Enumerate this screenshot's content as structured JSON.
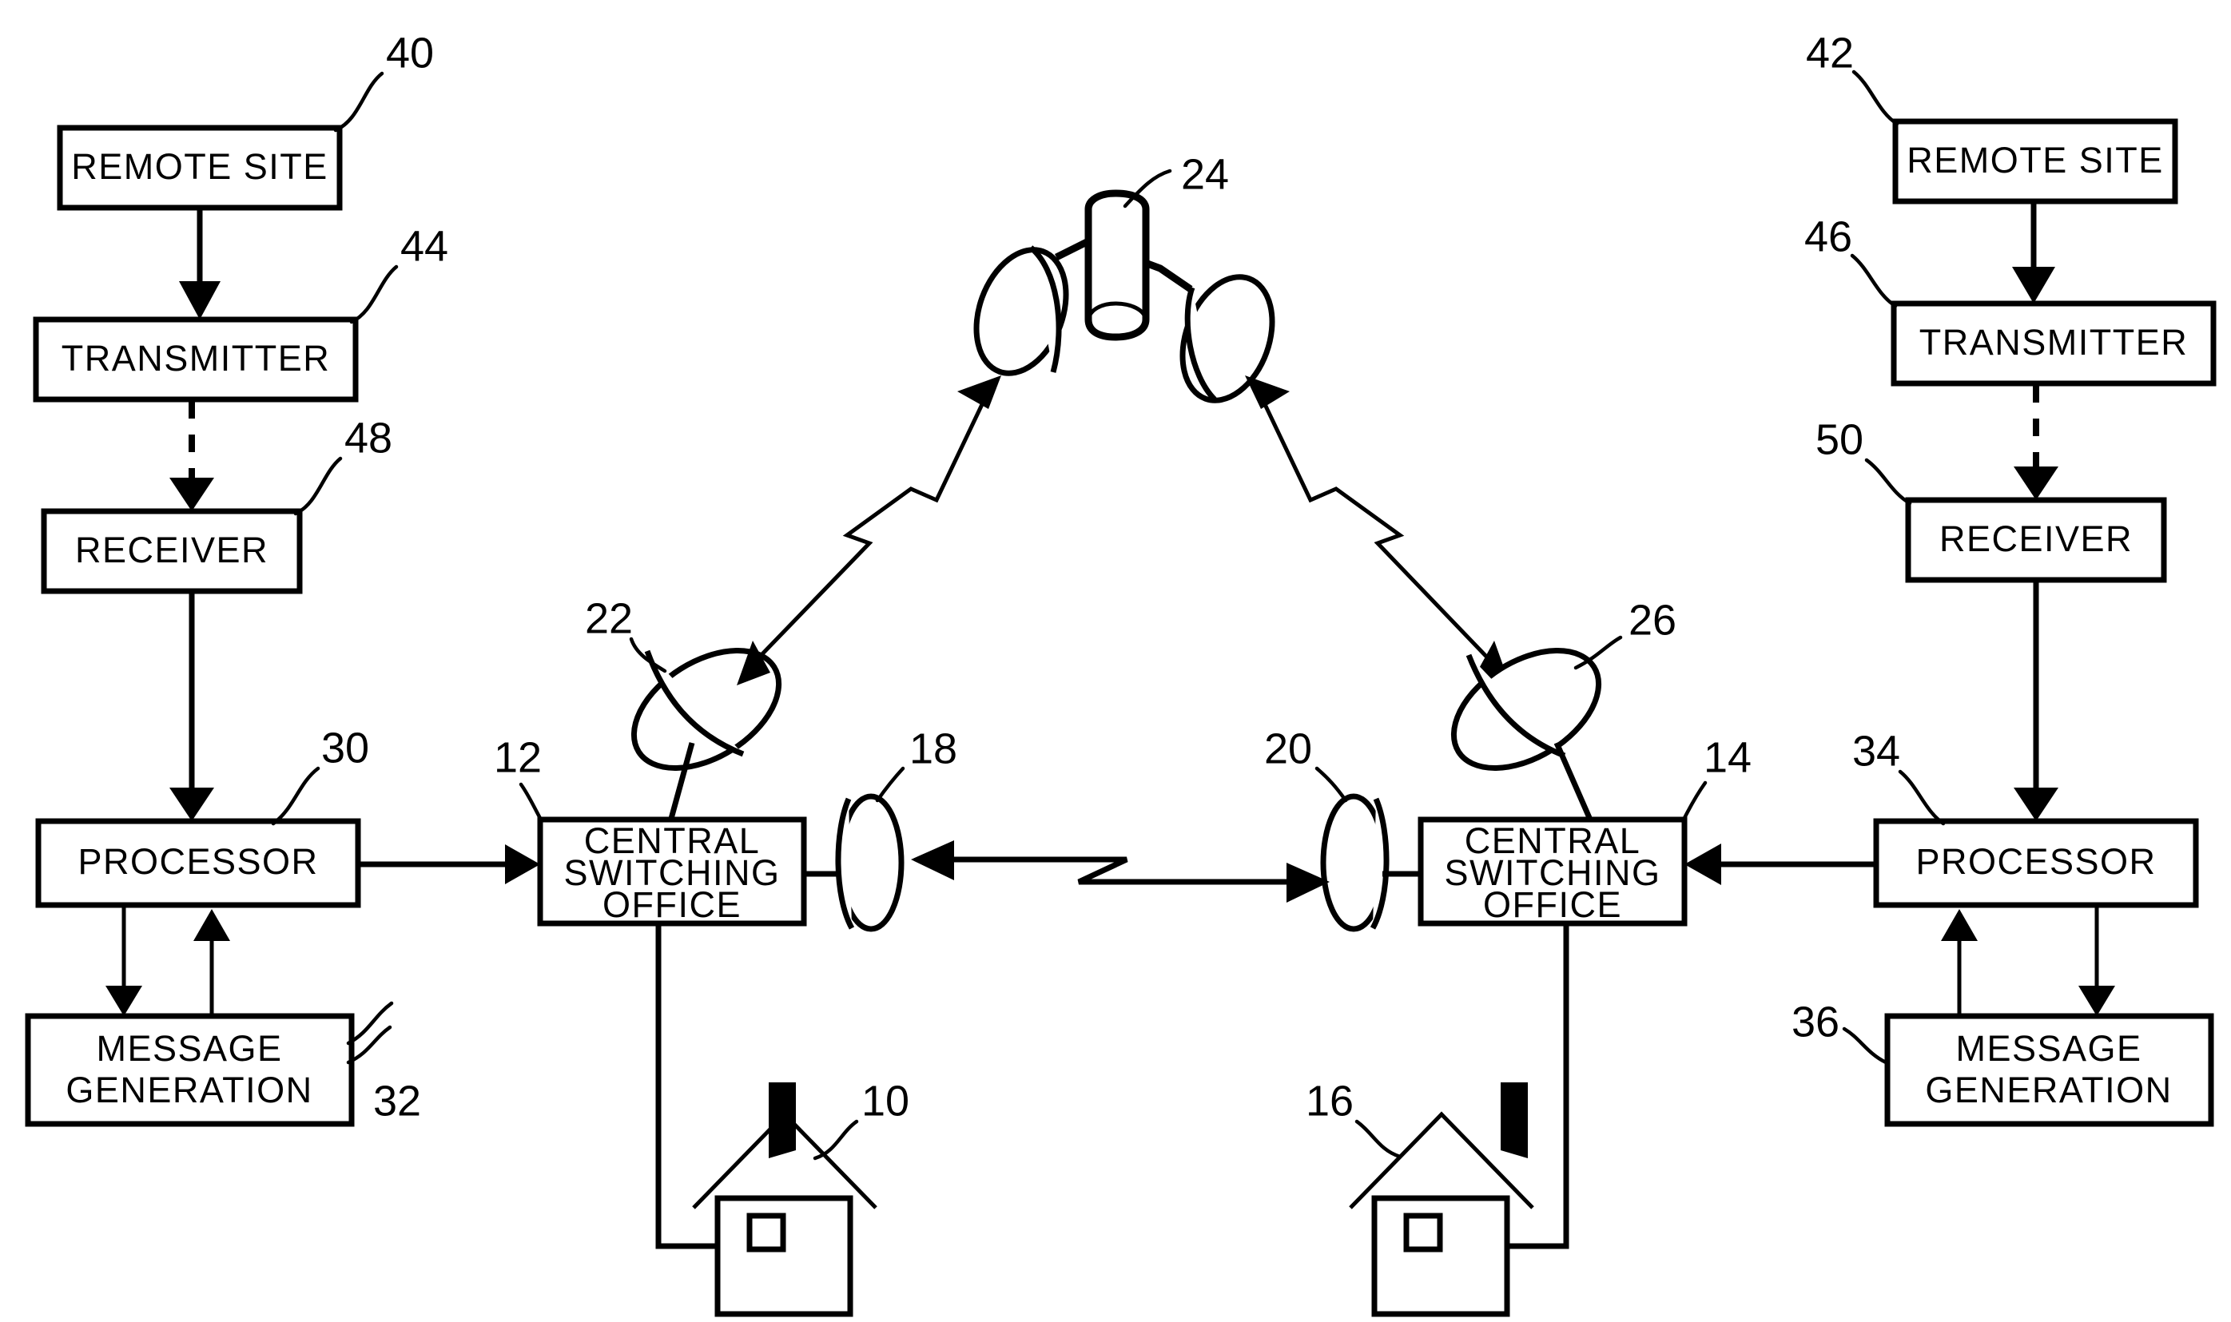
{
  "figure": {
    "type": "patent-block-diagram",
    "title": "Satellite and microwave messaging network",
    "background_color": "#ffffff",
    "ink_color": "#000000"
  },
  "blocks": {
    "remote_site_left": {
      "label": "REMOTE SITE",
      "ref": "40"
    },
    "transmitter_left": {
      "label": "TRANSMITTER",
      "ref": "44"
    },
    "receiver_left": {
      "label": "RECEIVER",
      "ref": "48"
    },
    "processor_left": {
      "label": "PROCESSOR",
      "ref": "30"
    },
    "message_generation_left": {
      "label_line1": "MESSAGE",
      "label_line2": "GENERATION",
      "ref": "32"
    },
    "central_switching_office_left": {
      "label_line1": "CENTRAL",
      "label_line2": "SWITCHING",
      "label_line3": "OFFICE",
      "ref": "12"
    },
    "central_switching_office_right": {
      "label_line1": "CENTRAL",
      "label_line2": "SWITCHING",
      "label_line3": "OFFICE",
      "ref": "14"
    },
    "remote_site_right": {
      "label": "REMOTE SITE",
      "ref": "42"
    },
    "transmitter_right": {
      "label": "TRANSMITTER",
      "ref": "46"
    },
    "receiver_right": {
      "label": "RECEIVER",
      "ref": "50"
    },
    "processor_right": {
      "label": "PROCESSOR",
      "ref": "34"
    },
    "message_generation_right": {
      "label_line1": "MESSAGE",
      "label_line2": "GENERATION",
      "ref": "36"
    }
  },
  "icons": {
    "satellite": {
      "name": "satellite-icon",
      "ref": "24"
    },
    "dish_left": {
      "name": "satellite-dish-icon",
      "ref": "22"
    },
    "dish_right": {
      "name": "satellite-dish-icon",
      "ref": "26"
    },
    "microwave_antenna_left": {
      "name": "microwave-antenna-icon",
      "ref": "18"
    },
    "microwave_antenna_right": {
      "name": "microwave-antenna-icon",
      "ref": "20"
    },
    "house_left": {
      "name": "house-icon",
      "ref": "10"
    },
    "house_right": {
      "name": "house-icon",
      "ref": "16"
    }
  },
  "links": {
    "uplink_left": {
      "name": "satellite-link-left",
      "style": "zigzag-double-arrow"
    },
    "uplink_right": {
      "name": "satellite-link-right",
      "style": "zigzag-double-arrow"
    },
    "microwave_link": {
      "name": "microwave-link",
      "style": "zigzag-double-arrow"
    },
    "wireless_left": {
      "name": "wireless-link-left",
      "style": "dashed-arrow"
    },
    "wireless_right": {
      "name": "wireless-link-right",
      "style": "dashed-arrow"
    }
  }
}
